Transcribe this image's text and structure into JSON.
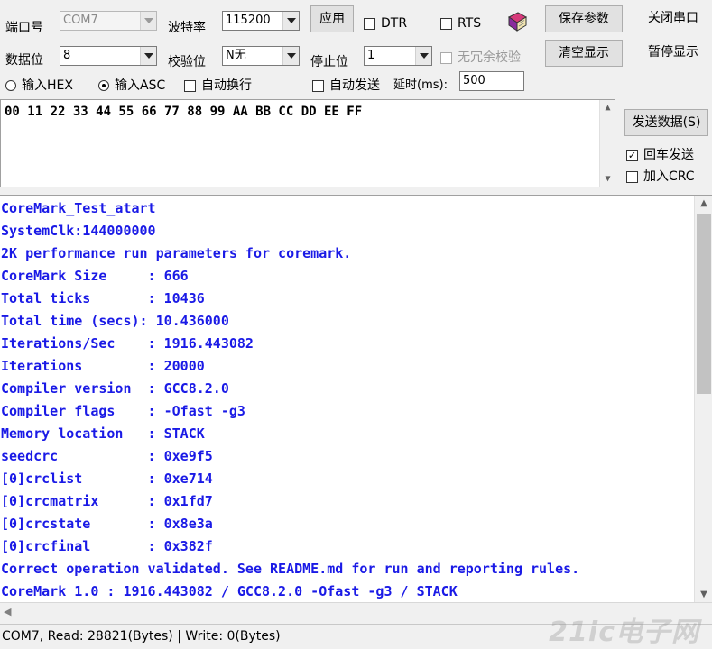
{
  "settings": {
    "port_label": "端口号",
    "port_value": "COM7",
    "baud_label": "波特率",
    "baud_value": "115200",
    "apply_label": "应用",
    "dtr_label": "DTR",
    "rts_label": "RTS",
    "save_params_label": "保存参数",
    "close_port_label": "关闭串口",
    "databits_label": "数据位",
    "databits_value": "8",
    "parity_label": "校验位",
    "parity_value": "N无",
    "stopbits_label": "停止位",
    "stopbits_value": "1",
    "no_redundant_check_label": "无冗余校验",
    "clear_display_label": "清空显示",
    "pause_display_label": "暂停显示",
    "input_hex_label": "输入HEX",
    "input_asc_label": "输入ASC",
    "auto_wrap_label": "自动换行",
    "auto_send_label": "自动发送",
    "delay_label": "延时(ms):",
    "delay_value": "500"
  },
  "send": {
    "text": "00 11 22 33 44 55 66 77 88 99 AA BB CC DD EE FF",
    "send_button_label": "发送数据(S)",
    "cr_send_label": "回车发送",
    "cr_send_checked": true,
    "add_crc_label": "加入CRC",
    "add_crc_checked": false
  },
  "receive": {
    "lines": [
      "CoreMark_Test_atart",
      "SystemClk:144000000",
      "2K performance run parameters for coremark.",
      "CoreMark Size     : 666",
      "Total ticks       : 10436",
      "Total time (secs): 10.436000",
      "Iterations/Sec    : 1916.443082",
      "Iterations        : 20000",
      "Compiler version  : GCC8.2.0",
      "Compiler flags    : -Ofast -g3",
      "Memory location   : STACK",
      "seedcrc           : 0xe9f5",
      "[0]crclist        : 0xe714",
      "[0]crcmatrix      : 0x1fd7",
      "[0]crcstate       : 0x8e3a",
      "[0]crcfinal       : 0x382f",
      "Correct operation validated. See README.md for run and reporting rules.",
      "CoreMark 1.0 : 1916.443082 / GCC8.2.0 -Ofast -g3 / STACK"
    ],
    "text_color": "#1a1ae6"
  },
  "status_bar": {
    "text": "COM7, Read: 28821(Bytes) | Write: 0(Bytes)"
  },
  "watermark": "21ic电子网",
  "icons": {
    "book": "book-icon"
  }
}
